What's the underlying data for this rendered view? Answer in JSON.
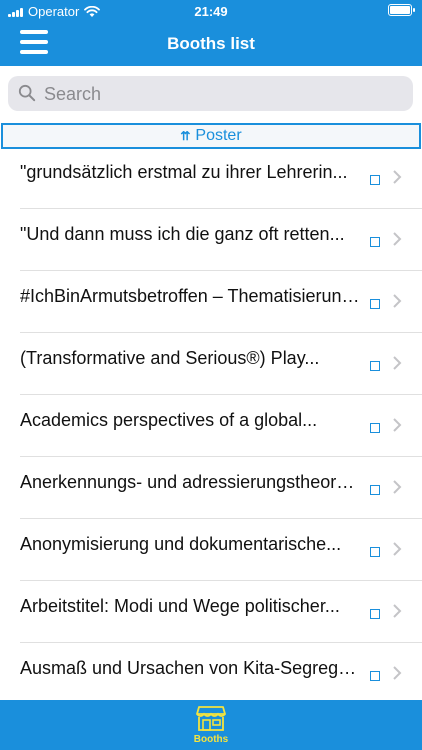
{
  "status": {
    "carrier": "Operator",
    "time": "21:49"
  },
  "header": {
    "title": "Booths list"
  },
  "search": {
    "placeholder": "Search"
  },
  "section": {
    "label": "Poster"
  },
  "items": [
    {
      "label": "\"grundsätzlich erstmal zu ihrer Lehrerin..."
    },
    {
      "label": "\"Und dann muss ich die ganz oft retten..."
    },
    {
      "label": "#IchBinArmutsbetroffen – Thematisierung..."
    },
    {
      "label": "(Transformative and Serious®) Play..."
    },
    {
      "label": "Academics perspectives of a global..."
    },
    {
      "label": "Anerkennungs- und adressierungstheoretische..."
    },
    {
      "label": "Anonymisierung und dokumentarische..."
    },
    {
      "label": "Arbeitstitel: Modi und Wege politischer..."
    },
    {
      "label": "Ausmaß und Ursachen von Kita-Segregation..."
    }
  ],
  "tabbar": {
    "booths_label": "Booths"
  },
  "colors": {
    "accent": "#1a8fdc",
    "tab_active": "#f3e33f"
  }
}
